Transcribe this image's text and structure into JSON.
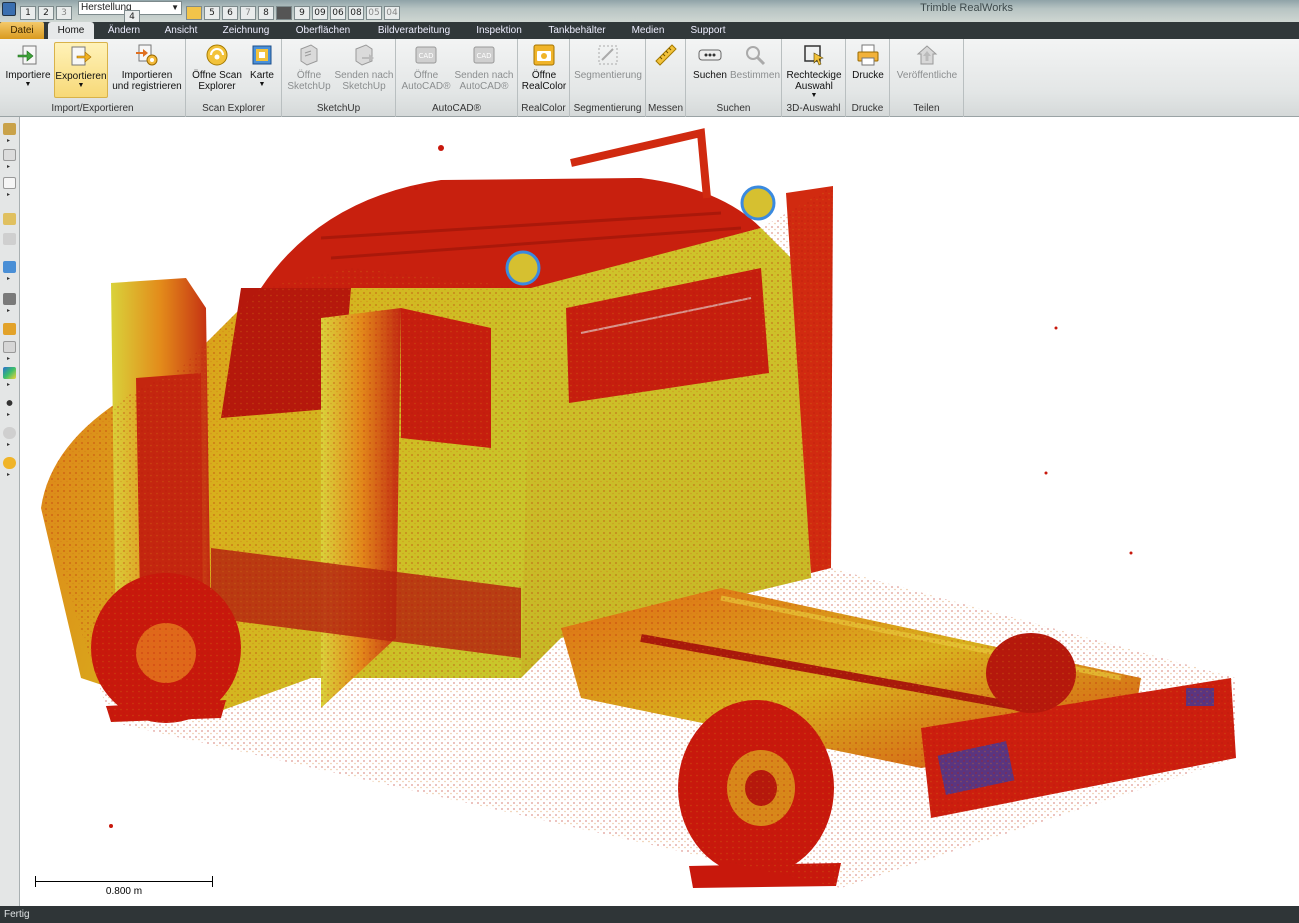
{
  "window": {
    "title": "Trimble RealWorks"
  },
  "quick_access": {
    "buttons": [
      "1",
      "2",
      "3",
      "4",
      "5",
      "6",
      "7",
      "8",
      "9",
      "09",
      "06",
      "08",
      "05",
      "04"
    ],
    "combo_value": "Herstellung"
  },
  "tabs": [
    "Datei",
    "Home",
    "Ändern",
    "Ansicht",
    "Zeichnung",
    "Oberflächen",
    "Bildverarbeitung",
    "Inspektion",
    "Tankbehälter",
    "Medien",
    "Support"
  ],
  "ribbon": {
    "import_export": {
      "label": "Import/Exportieren",
      "import": "Importiere",
      "export": "Exportieren",
      "import_register_1": "Importieren",
      "import_register_2": "und registrieren"
    },
    "scan_explorer": {
      "label": "Scan Explorer",
      "open_1": "Öffne Scan",
      "open_2": "Explorer",
      "map": "Karte"
    },
    "sketchup": {
      "label": "SketchUp",
      "open_1": "Öffne",
      "open_2": "SketchUp",
      "send_1": "Senden nach",
      "send_2": "SketchUp"
    },
    "autocad": {
      "label": "AutoCAD®",
      "open_1": "Öffne",
      "open_2": "AutoCAD®",
      "send_1": "Senden nach",
      "send_2": "AutoCAD®",
      "icon_text": "CAD"
    },
    "realcolor": {
      "label": "RealColor",
      "open_1": "Öffne",
      "open_2": "RealColor"
    },
    "segmentation": {
      "label": "Segmentierung",
      "button": "Segmentierung"
    },
    "measure": {
      "label": "Messen"
    },
    "search": {
      "label": "Suchen",
      "search": "Suchen",
      "determine": "Bestimmen"
    },
    "selection3d": {
      "label": "3D-Auswahl",
      "rect_1": "Rechteckige",
      "rect_2": "Auswahl"
    },
    "print": {
      "label": "Drucke",
      "button": "Drucke"
    },
    "share": {
      "label": "Teilen",
      "button": "Veröffentliche"
    }
  },
  "viewport": {
    "scale_label": "0.800 m"
  },
  "status": {
    "text": "Fertig"
  },
  "colors": {
    "accent_file_tab": "#e0a22a",
    "ribbon_bg": "#e6e8e8",
    "tabrow_bg": "#31383a",
    "cloud_red": "#d01a10",
    "cloud_orange": "#e86a12",
    "cloud_yellow": "#d9c21e",
    "cloud_green": "#b9d23a"
  }
}
